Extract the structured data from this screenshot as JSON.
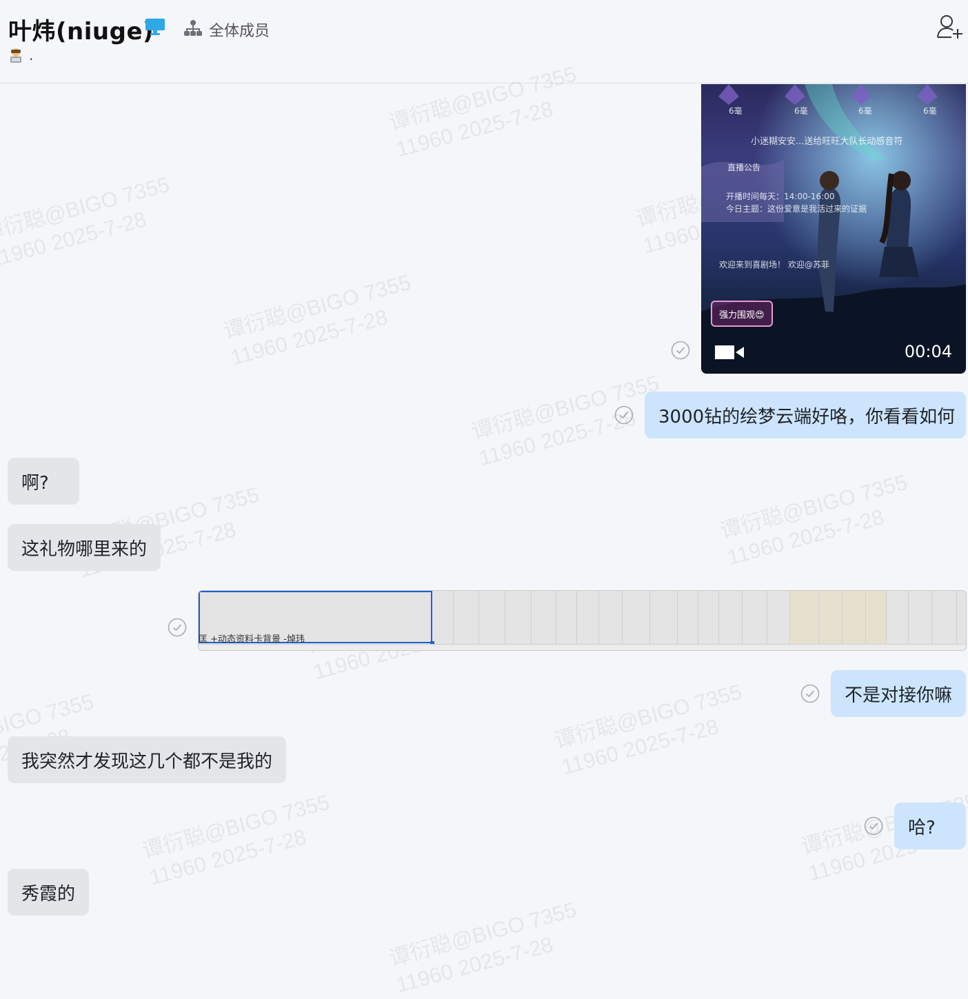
{
  "header": {
    "title": "叶炜(niuge)",
    "members_label": "全体成员",
    "status_text": "."
  },
  "watermark": {
    "line1": "谭衍聪@BIGO 7355",
    "line2": "11960 2025-7-28"
  },
  "video": {
    "duration": "00:04",
    "overlay": {
      "level": "6毫",
      "banner": "小迷糊安安...送给旺旺大队长动感音符",
      "notice": "直播公告",
      "schedule": "开播时间每天：14:00-16:00",
      "topic": "今日主题：这份爱意是我活过来的证据",
      "welcome": "欢迎来到喜剧场！ 欢迎@苏菲",
      "tag": "强力围观😍"
    }
  },
  "messages": {
    "m1": "3000钻的绘梦云端好咯，你看看如何",
    "m2": "啊?",
    "m3": "这礼物哪里来的",
    "m4": "不是对接你嘛",
    "m5": "我突然才发现这几个都不是我的",
    "m6": "哈?",
    "m7": "秀霞的"
  },
  "sheet": {
    "caption": "匡 +动态资料卡背景 -焯玮"
  },
  "colors": {
    "incoming_bubble": "#e3e5e9",
    "outgoing_bubble": "#cce5fc",
    "selection": "#1f5fd1"
  }
}
